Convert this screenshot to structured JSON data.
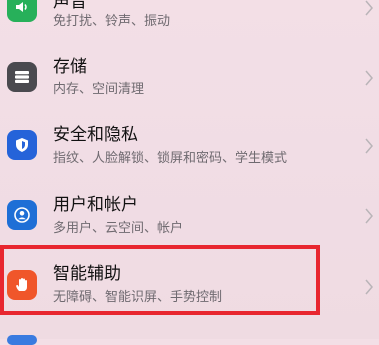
{
  "settings": {
    "items": [
      {
        "title": "声音",
        "subtitle": "免打扰、铃声、振动",
        "icon": "speaker-icon",
        "icon_color": "#27b05a"
      },
      {
        "title": "存储",
        "subtitle": "内存、空间清理",
        "icon": "storage-icon",
        "icon_color": "#4a4a4f"
      },
      {
        "title": "安全和隐私",
        "subtitle": "指纹、人脸解锁、锁屏和密码、学生模式",
        "icon": "shield-icon",
        "icon_color": "#2563d9"
      },
      {
        "title": "用户和帐户",
        "subtitle": "多用户、云空间、帐户",
        "icon": "user-icon",
        "icon_color": "#1e6fd6"
      },
      {
        "title": "智能辅助",
        "subtitle": "无障碍、智能识屏、手势控制",
        "icon": "hand-icon",
        "icon_color": "#f0562a"
      }
    ],
    "highlight_color": "#e8262f"
  }
}
